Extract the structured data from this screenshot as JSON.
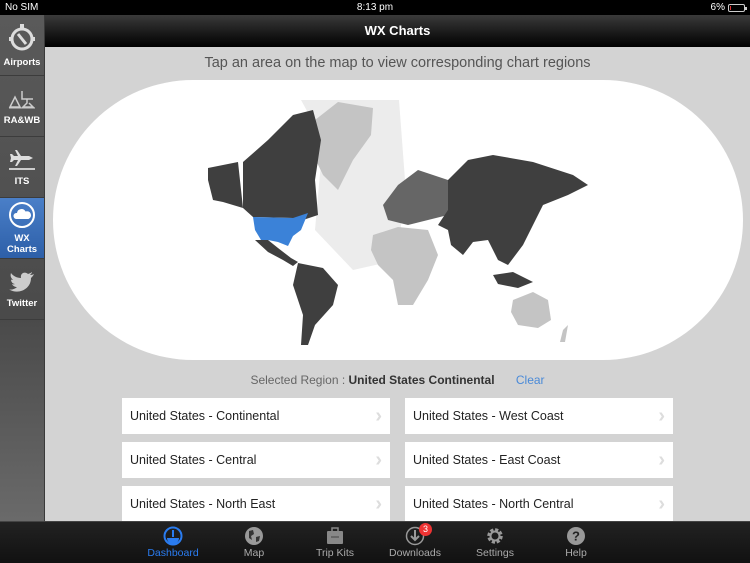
{
  "status_bar": {
    "carrier": "No SIM",
    "time": "8:13 pm",
    "battery": "6%",
    "battery_level": 0.06
  },
  "sidebar": {
    "items": [
      {
        "label": "Airports",
        "icon": "compass-icon"
      },
      {
        "label": "RA&WB",
        "icon": "scale-icon"
      },
      {
        "label": "ITS",
        "icon": "airplane-icon"
      },
      {
        "label": "WX Charts",
        "icon": "cloud-icon",
        "active": true
      },
      {
        "label": "Twitter",
        "icon": "twitter-bird-icon"
      }
    ]
  },
  "navbar": {
    "title": "WX Charts"
  },
  "main": {
    "prompt": "Tap an area on the map to view corresponding chart regions",
    "selected_label": "Selected Region :",
    "selected_value": "United States Continental",
    "clear_label": "Clear",
    "map_colors": {
      "selected": "#3b82d8",
      "dark": "#3f3f3f",
      "medium": "#666666",
      "light": "#c4c4c4",
      "region_bg": "#ececec"
    },
    "regions": [
      "United States - Continental",
      "United States - West Coast",
      "United States - Central",
      "United States - East Coast",
      "United States - North East",
      "United States - North Central"
    ]
  },
  "tabbar": {
    "items": [
      {
        "label": "Dashboard",
        "icon": "dashboard-icon",
        "active": true
      },
      {
        "label": "Map",
        "icon": "globe-icon"
      },
      {
        "label": "Trip Kits",
        "icon": "briefcase-icon"
      },
      {
        "label": "Downloads",
        "icon": "download-icon",
        "badge": "3"
      },
      {
        "label": "Settings",
        "icon": "gear-icon"
      },
      {
        "label": "Help",
        "icon": "help-icon"
      }
    ]
  }
}
